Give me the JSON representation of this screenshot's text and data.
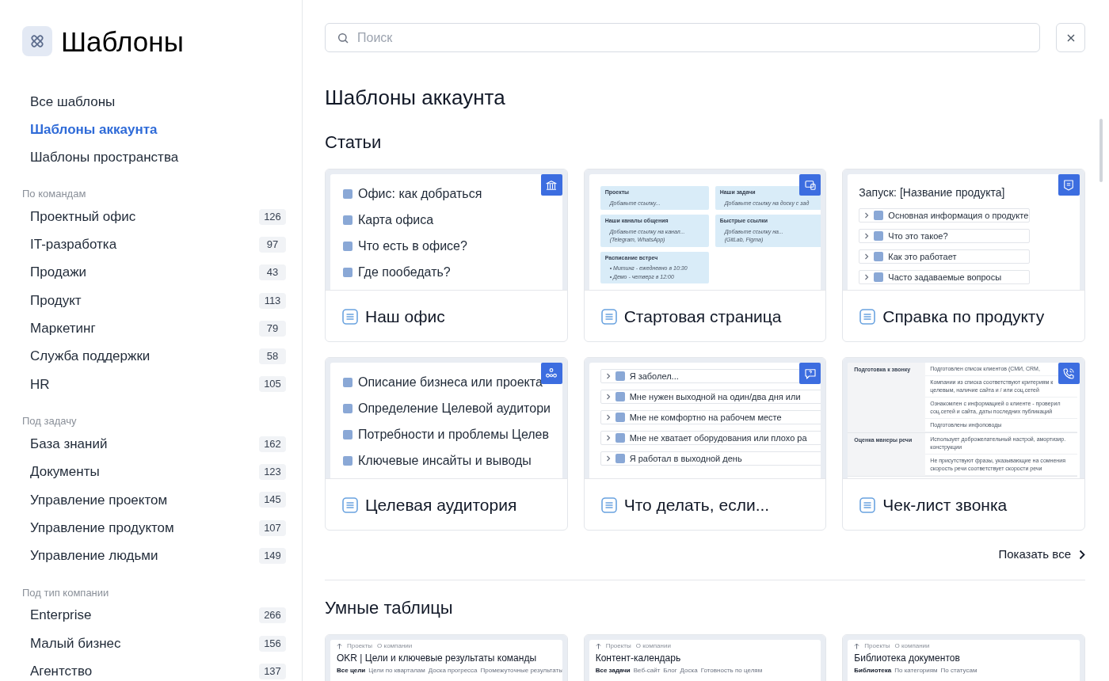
{
  "sidebar": {
    "title": "Шаблоны",
    "nav": [
      {
        "label": "Все шаблоны",
        "selected": false
      },
      {
        "label": "Шаблоны аккаунта",
        "selected": true
      },
      {
        "label": "Шаблоны пространства",
        "selected": false
      }
    ],
    "groups": [
      {
        "heading": "По командам",
        "items": [
          {
            "label": "Проектный офис",
            "count": "126"
          },
          {
            "label": "IT-разработка",
            "count": "97"
          },
          {
            "label": "Продажи",
            "count": "43"
          },
          {
            "label": "Продукт",
            "count": "113"
          },
          {
            "label": "Маркетинг",
            "count": "79"
          },
          {
            "label": "Служба поддержки",
            "count": "58"
          },
          {
            "label": "HR",
            "count": "105"
          }
        ]
      },
      {
        "heading": "Под задачу",
        "items": [
          {
            "label": "База знаний",
            "count": "162"
          },
          {
            "label": "Документы",
            "count": "123"
          },
          {
            "label": "Управление проектом",
            "count": "145"
          },
          {
            "label": "Управление продуктом",
            "count": "107"
          },
          {
            "label": "Управление людьми",
            "count": "149"
          }
        ]
      },
      {
        "heading": "Под тип компании",
        "items": [
          {
            "label": "Enterprise",
            "count": "266"
          },
          {
            "label": "Малый бизнес",
            "count": "156"
          },
          {
            "label": "Агентство",
            "count": "137"
          }
        ]
      }
    ]
  },
  "search": {
    "placeholder": "Поиск"
  },
  "heading": "Шаблоны аккаунта",
  "sections": [
    {
      "title": "Статьи",
      "show_all": "Показать все",
      "cards": [
        {
          "title": "Наш офис",
          "preview": {
            "kind": "list",
            "lines": [
              "Офис: как добраться",
              "Карта офиса",
              "Что есть в офисе?",
              "Где пообедать?"
            ]
          }
        },
        {
          "title": "Стартовая страница",
          "preview": {
            "kind": "blocks",
            "blocks": [
              {
                "title": "Проекты",
                "lines": [
                  "Добавьте ссылку..."
                ]
              },
              {
                "title": "Наши задачи",
                "lines": [
                  "Добавьте ссылку на доску с зад"
                ]
              },
              {
                "title": "Наши каналы общения",
                "lines": [
                  "Добавьте ссылку на канал...",
                  "(Telegram, WhatsApp)"
                ]
              },
              {
                "title": "Быстрые ссылки",
                "lines": [
                  "Добавьте ссылку на...",
                  "(GitLab, Figma)"
                ]
              },
              {
                "title": "Расписание встреч",
                "lines": [
                  "• Митинг - ежедневно в 10:30",
                  "• Демо - четверг в 12:00"
                ]
              }
            ]
          }
        },
        {
          "title": "Справка по продукту",
          "preview": {
            "kind": "toggles",
            "heading": "Запуск: [Название продукта]",
            "lines": [
              "Основная информация о продукте",
              "Что это такое?",
              "Как это работает",
              "Часто задаваемые вопросы"
            ]
          }
        },
        {
          "title": "Целевая аудитория",
          "preview": {
            "kind": "list",
            "lines": [
              "Описание бизнеса или проекта",
              "Определение Целевой аудитори",
              "Потребности и проблемы Целев",
              "Ключевые инсайты и выводы"
            ]
          }
        },
        {
          "title": "Что делать, если...",
          "preview": {
            "kind": "toggles",
            "lines": [
              "Я заболел...",
              "Мне нужен выходной на один/два дня или",
              "Мне не комфортно на рабочем месте",
              "Мне не хватает оборудования или плохо ра",
              "Я работал в выходной день"
            ]
          }
        },
        {
          "title": "Чек-лист звонка",
          "preview": {
            "kind": "table",
            "rows": [
              {
                "label": "Подготовка к звонку",
                "cells": [
                  "Подготовлен список клиентов (СМИ, CRM,",
                  "Компании из списка соответствуют критериям к целевым, наличие сайта и / или соц.сетей",
                  "Ознакомлен с информацией о клиенте - проверил соц.сетей и сайта, даты последних публикаций",
                  "Подготовлены инфоповоды"
                ]
              },
              {
                "label": "Оценка манеры речи",
                "cells": [
                  "Использует доброжелательный настрой, амортизир. конструкции",
                  "Не присутствуют фразы, указывающие на сомнения скорость речи соответствует скорости речи"
                ]
              }
            ]
          }
        }
      ]
    },
    {
      "title": "Умные таблицы",
      "cards": [
        {
          "preview": {
            "kind": "sheet",
            "crumbs": [
              "Проекты",
              "О компании"
            ],
            "heading": "OKR | Цели и ключевые результаты команды",
            "tabs": [
              "Все цели",
              "Цели по кварталам",
              "Доска прогресса",
              "Промежуточные результаты"
            ]
          }
        },
        {
          "preview": {
            "kind": "sheet",
            "crumbs": [
              "Проекты",
              "О компании"
            ],
            "heading": "Контент-календарь",
            "tabs": [
              "Все задачи",
              "Веб-сайт",
              "Блог",
              "Доска",
              "Готовность по целям"
            ]
          }
        },
        {
          "preview": {
            "kind": "sheet",
            "crumbs": [
              "Проекты",
              "О компании"
            ],
            "heading": "Библиотека документов",
            "tabs": [
              "Библиотека",
              "По категориям",
              "По статусам"
            ]
          }
        }
      ]
    }
  ]
}
